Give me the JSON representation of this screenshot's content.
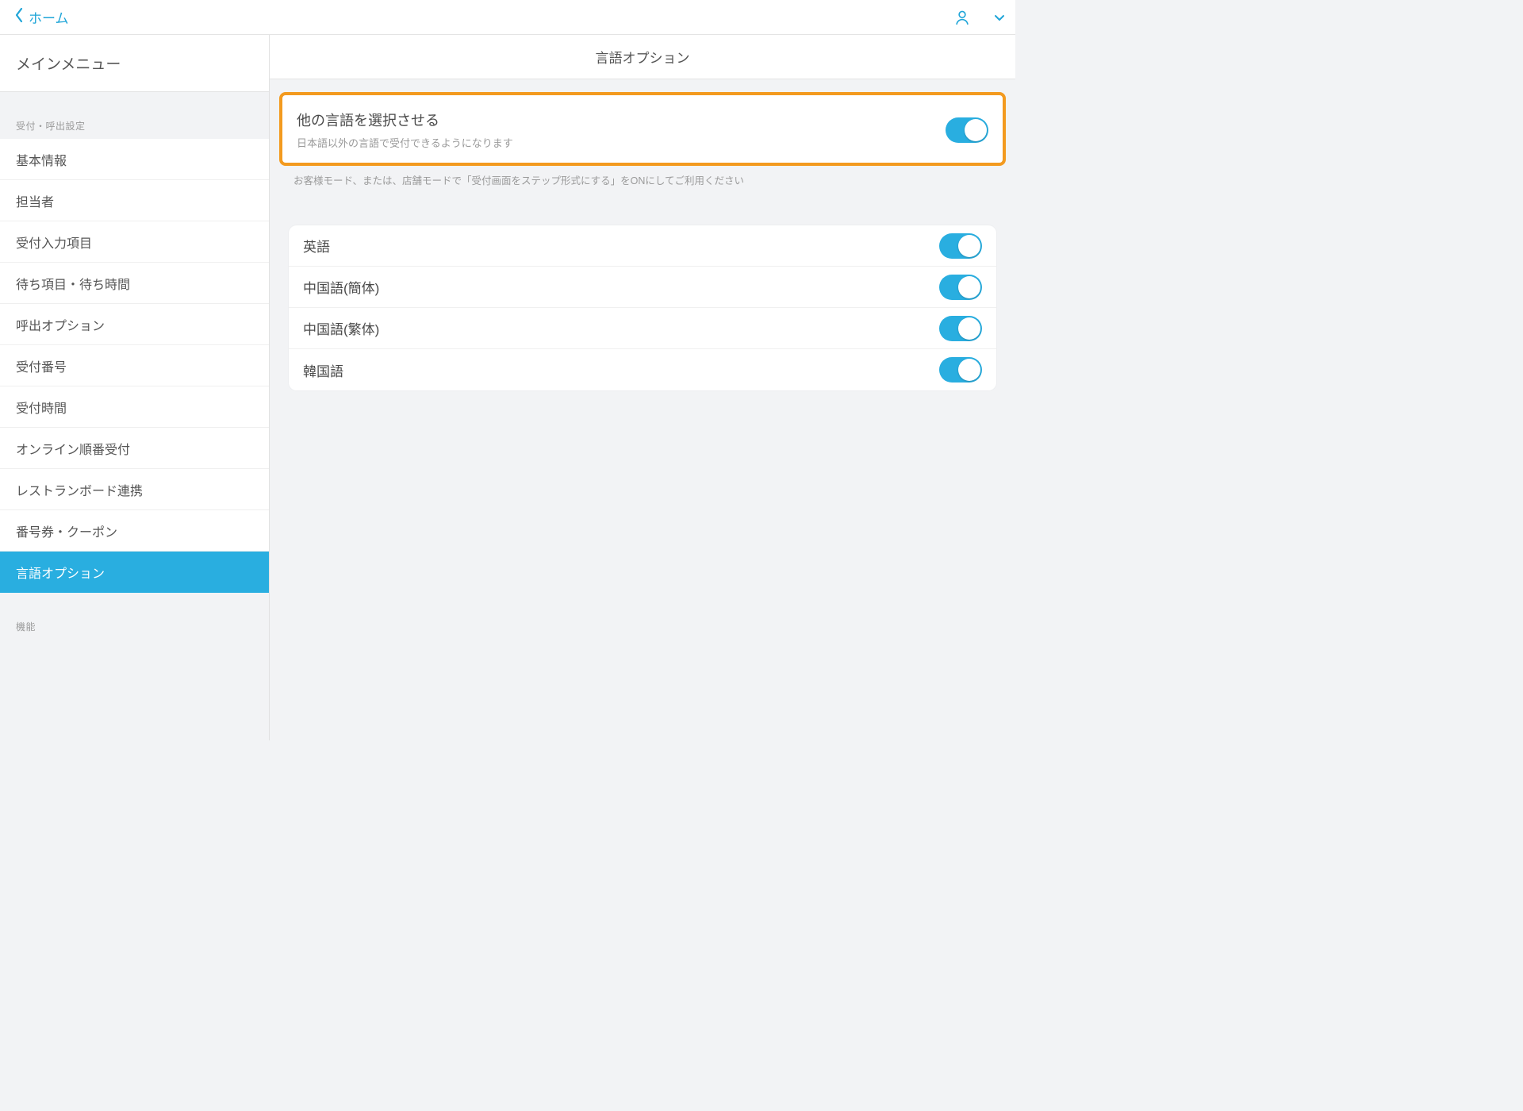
{
  "topbar": {
    "back_label": "ホーム"
  },
  "sidebar": {
    "main_menu_label": "メインメニュー",
    "section1_label": "受付・呼出設定",
    "items": [
      {
        "label": "基本情報"
      },
      {
        "label": "担当者"
      },
      {
        "label": "受付入力項目"
      },
      {
        "label": "待ち項目・待ち時間"
      },
      {
        "label": "呼出オプション"
      },
      {
        "label": "受付番号"
      },
      {
        "label": "受付時間"
      },
      {
        "label": "オンライン順番受付"
      },
      {
        "label": "レストランボード連携"
      },
      {
        "label": "番号券・クーポン"
      },
      {
        "label": "言語オプション"
      }
    ],
    "section2_label": "機能"
  },
  "content": {
    "title": "言語オプション",
    "allow_other_lang": {
      "title": "他の言語を選択させる",
      "subtitle": "日本語以外の言語で受付できるようになります",
      "enabled": true
    },
    "helper_note": "お客様モード、または、店舗モードで「受付画面をステップ形式にする」をONにしてご利用ください",
    "languages": [
      {
        "label": "英語",
        "enabled": true
      },
      {
        "label": "中国語(簡体)",
        "enabled": true
      },
      {
        "label": "中国語(繁体)",
        "enabled": true
      },
      {
        "label": "韓国語",
        "enabled": true
      }
    ]
  }
}
